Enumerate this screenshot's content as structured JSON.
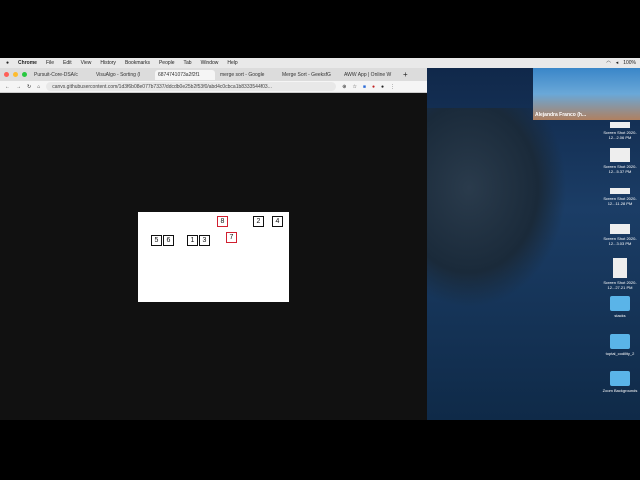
{
  "menubar": {
    "app": "Chrome",
    "items": [
      "File",
      "Edit",
      "View",
      "History",
      "Bookmarks",
      "People",
      "Tab",
      "Window",
      "Help"
    ],
    "battery": "100%"
  },
  "tabs": [
    {
      "label": "Pursuit-Core-DSA/c",
      "active": false
    },
    {
      "label": "VisuAlgo - Sorting (I",
      "active": false
    },
    {
      "label": "6874741073a2f2f1",
      "active": true
    },
    {
      "label": "merge sort - Google",
      "active": false
    },
    {
      "label": "Merge Sort - GeeksfG",
      "active": false
    },
    {
      "label": "AWW App | Online W",
      "active": false
    }
  ],
  "url": "canvs.githubusercontent.com/1d3f6b08e077b7337/ddcdb0e25b2f53f0/abd4c0cbca1b8333544f03...",
  "sort_boxes": [
    {
      "value": "8",
      "highlight": true
    },
    {
      "value": "2",
      "highlight": false
    },
    {
      "value": "4",
      "highlight": false
    },
    {
      "value": "7",
      "highlight": true
    },
    {
      "value": "5",
      "highlight": false
    },
    {
      "value": "6",
      "highlight": false
    },
    {
      "value": "1",
      "highlight": false
    },
    {
      "value": "3",
      "highlight": false
    }
  ],
  "colors": {
    "highlight": "#d02030"
  },
  "zoom_participant": "Alejandra Franco (h...",
  "desktop_icons": [
    {
      "label": "Screen Shot 2020-12...2.06 PM",
      "type": "image"
    },
    {
      "label": "Screen Shot 2020-12...5.37 PM",
      "type": "image"
    },
    {
      "label": "Screen Shot 2020-12...11.28 PM",
      "type": "image"
    },
    {
      "label": "Screen Shot 2020-12...3.03 PM",
      "type": "image"
    },
    {
      "label": "Screen Shot 2020-12...27.21 PM",
      "type": "image"
    },
    {
      "label": "stacks",
      "type": "folder"
    },
    {
      "label": "toptal_codility_2",
      "type": "folder"
    },
    {
      "label": "Zoom Backgrounds",
      "type": "folder"
    }
  ]
}
